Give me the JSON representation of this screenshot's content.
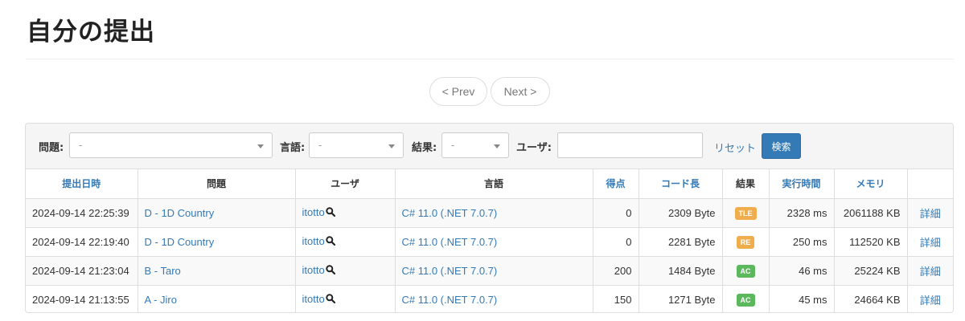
{
  "page": {
    "title": "自分の提出"
  },
  "pager": {
    "prev_label": "< Prev",
    "next_label": "Next >"
  },
  "filter": {
    "problem_label": "問題:",
    "problem_value": "-",
    "language_label": "言語:",
    "language_value": "-",
    "result_label": "結果:",
    "result_value": "-",
    "user_label": "ユーザ:",
    "user_value": "",
    "reset_label": "リセット",
    "search_label": "検索"
  },
  "table": {
    "headers": [
      "提出日時",
      "問題",
      "ユーザ",
      "言語",
      "得点",
      "コード長",
      "結果",
      "実行時間",
      "メモリ",
      ""
    ],
    "rows": [
      {
        "time": "2024-09-14 22:25:39",
        "problem": "D - 1D Country",
        "user": "itotto",
        "language": "C# 11.0 (.NET 7.0.7)",
        "score": "0",
        "code_length": "2309 Byte",
        "result": "TLE",
        "result_color": "#f0ad4e",
        "exec_time": "2328 ms",
        "memory": "2061188 KB",
        "detail": "詳細"
      },
      {
        "time": "2024-09-14 22:19:40",
        "problem": "D - 1D Country",
        "user": "itotto",
        "language": "C# 11.0 (.NET 7.0.7)",
        "score": "0",
        "code_length": "2281 Byte",
        "result": "RE",
        "result_color": "#f0ad4e",
        "exec_time": "250 ms",
        "memory": "112520 KB",
        "detail": "詳細"
      },
      {
        "time": "2024-09-14 21:23:04",
        "problem": "B - Taro",
        "user": "itotto",
        "language": "C# 11.0 (.NET 7.0.7)",
        "score": "200",
        "code_length": "1484 Byte",
        "result": "AC",
        "result_color": "#5cb85c",
        "exec_time": "46 ms",
        "memory": "25224 KB",
        "detail": "詳細"
      },
      {
        "time": "2024-09-14 21:13:55",
        "problem": "A - Jiro",
        "user": "itotto",
        "language": "C# 11.0 (.NET 7.0.7)",
        "score": "150",
        "code_length": "1271 Byte",
        "result": "AC",
        "result_color": "#5cb85c",
        "exec_time": "45 ms",
        "memory": "24664 KB",
        "detail": "詳細"
      }
    ]
  },
  "colors": {
    "link": "#337ab7",
    "primary_button": "#337ab7",
    "badge_warning": "#f0ad4e",
    "badge_success": "#5cb85c"
  },
  "icons": {
    "user_search": "magnifier-icon",
    "select_caret": "caret-down-icon"
  }
}
